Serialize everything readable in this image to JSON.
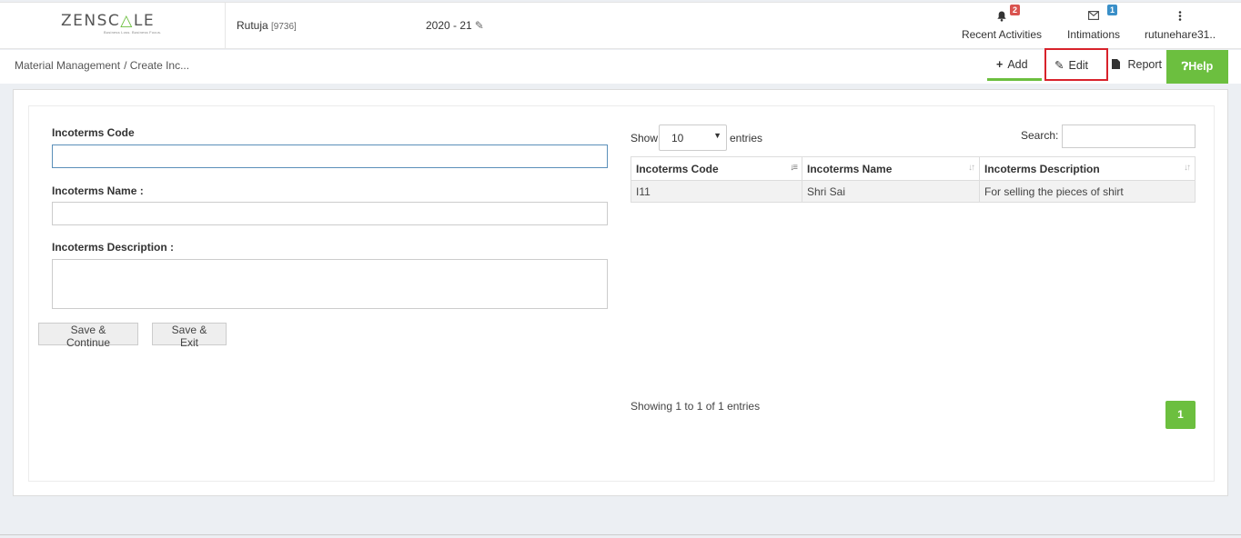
{
  "header": {
    "logo_text_main": "ZENSC",
    "logo_text_accent": "△",
    "logo_text_end": "LE",
    "logo_tagline": "Business Loss. Business Focus.",
    "user_name": "Rutuja",
    "user_id": "[9736]",
    "financial_year": "2020 - 21",
    "recent_activities": {
      "label": "Recent Activities",
      "count": "2"
    },
    "intimations": {
      "label": "Intimations",
      "count": "1"
    },
    "user_menu": {
      "label": "rutunehare31.."
    }
  },
  "breadcrumb": {
    "module": "Material Management",
    "page": "/ Create Inc..."
  },
  "tabs": {
    "add": "Add",
    "edit": "Edit",
    "report": "Report",
    "help": "Help"
  },
  "form": {
    "code_label": "Incoterms Code",
    "name_label": "Incoterms Name :",
    "description_label": "Incoterms Description :",
    "code_value": "",
    "name_value": "",
    "description_value": "",
    "save_continue": "Save & Continue",
    "save_exit": "Save & Exit"
  },
  "table": {
    "show_label": "Show",
    "page_size": "10",
    "entries_label": "entries",
    "search_label": "Search:",
    "columns": [
      "Incoterms Code",
      "Incoterms Name",
      "Incoterms Description"
    ],
    "rows": [
      [
        "I11",
        "Shri Sai",
        "For selling the pieces of shirt"
      ]
    ],
    "info": "Showing 1 to 1 of 1 entries",
    "current_page": "1"
  },
  "colors": {
    "accent_green": "#6cbf3f",
    "highlight_red": "#d8222b",
    "badge_red": "#d9534f",
    "badge_blue": "#3a8fc8"
  }
}
